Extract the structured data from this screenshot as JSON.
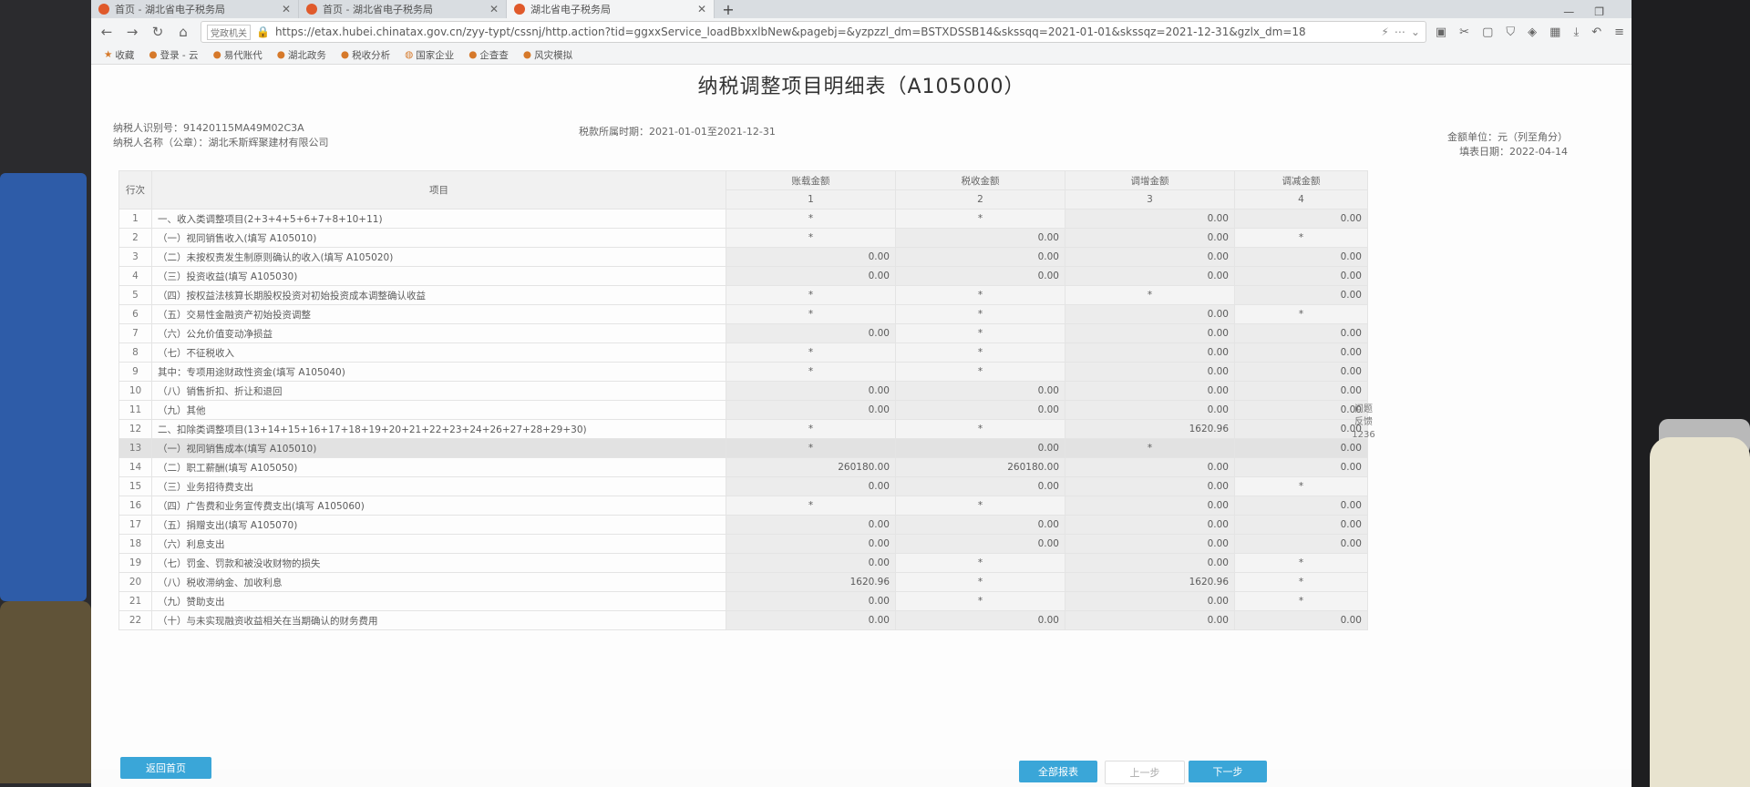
{
  "browser": {
    "tabs": [
      {
        "label": "首页 - 湖北省电子税务局",
        "active": false
      },
      {
        "label": "首页 - 湖北省电子税务局",
        "active": false
      },
      {
        "label": "湖北省电子税务局",
        "active": true
      }
    ],
    "new_tab": "+",
    "url_badge": "党政机关",
    "url": "https://etax.hubei.chinatax.gov.cn/zyy-typt/cssnj/http.action?tid=ggxxService_loadBbxxlbNew&pagebj=&yzpzzl_dm=BSTXDSSB14&skssqq=2021-01-01&skssqz=2021-12-31&gzlx_dm=18",
    "bookmarks": [
      "收藏",
      "登录 - 云",
      "易代账代",
      "湖北政务",
      "税收分析",
      "国家企业",
      "企查查",
      "风灾模拟"
    ]
  },
  "page": {
    "title": "纳税调整项目明细表（A105000）",
    "taxpayer_id": "纳税人识别号：91420115MA49M02C3A",
    "taxpayer_name": "纳税人名称（公章）：湖北禾斯辉聚建材有限公司",
    "period": "税款所属时期：2021-01-01至2021-12-31",
    "unit": "金额单位：元（列至角分）",
    "fill_date": "填表日期：2022-04-14",
    "side_float": [
      "问题",
      "反馈",
      "1236"
    ]
  },
  "table": {
    "headers": {
      "row_no": "行次",
      "item": "项目",
      "col1": "账载金额",
      "col2": "税收金额",
      "col3": "调增金额",
      "col4": "调减金额",
      "idx1": "1",
      "idx2": "2",
      "idx3": "3",
      "idx4": "4"
    },
    "rows": [
      {
        "no": "1",
        "item": "一、收入类调整项目(2+3+4+5+6+7+8+10+11)",
        "c1": "*",
        "c2": "*",
        "c3": "0.00",
        "c4": "0.00"
      },
      {
        "no": "2",
        "item": "（一）视同销售收入(填写 A105010)",
        "c1": "*",
        "c2": "0.00",
        "c3": "0.00",
        "c4": "*"
      },
      {
        "no": "3",
        "item": "（二）未按权责发生制原则确认的收入(填写 A105020)",
        "c1": "0.00",
        "c2": "0.00",
        "c3": "0.00",
        "c4": "0.00"
      },
      {
        "no": "4",
        "item": "（三）投资收益(填写 A105030)",
        "c1": "0.00",
        "c2": "0.00",
        "c3": "0.00",
        "c4": "0.00"
      },
      {
        "no": "5",
        "item": "（四）按权益法核算长期股权投资对初始投资成本调整确认收益",
        "c1": "*",
        "c2": "*",
        "c3": "*",
        "c4": "0.00"
      },
      {
        "no": "6",
        "item": "（五）交易性金融资产初始投资调整",
        "c1": "*",
        "c2": "*",
        "c3": "0.00",
        "c4": "*"
      },
      {
        "no": "7",
        "item": "（六）公允价值变动净损益",
        "c1": "0.00",
        "c2": "*",
        "c3": "0.00",
        "c4": "0.00"
      },
      {
        "no": "8",
        "item": "（七）不征税收入",
        "c1": "*",
        "c2": "*",
        "c3": "0.00",
        "c4": "0.00"
      },
      {
        "no": "9",
        "item": "其中：专项用途财政性资金(填写 A105040)",
        "c1": "*",
        "c2": "*",
        "c3": "0.00",
        "c4": "0.00"
      },
      {
        "no": "10",
        "item": "（八）销售折扣、折让和退回",
        "c1": "0.00",
        "c2": "0.00",
        "c3": "0.00",
        "c4": "0.00"
      },
      {
        "no": "11",
        "item": "（九）其他",
        "c1": "0.00",
        "c2": "0.00",
        "c3": "0.00",
        "c4": "0.00"
      },
      {
        "no": "12",
        "item": "二、扣除类调整项目(13+14+15+16+17+18+19+20+21+22+23+24+26+27+28+29+30)",
        "c1": "*",
        "c2": "*",
        "c3": "1620.96",
        "c4": "0.00"
      },
      {
        "no": "13",
        "item": "（一）视同销售成本(填写 A105010)",
        "c1": "*",
        "c2": "0.00",
        "c3": "*",
        "c4": "0.00"
      },
      {
        "no": "14",
        "item": "（二）职工薪酬(填写 A105050)",
        "c1": "260180.00",
        "c2": "260180.00",
        "c3": "0.00",
        "c4": "0.00"
      },
      {
        "no": "15",
        "item": "（三）业务招待费支出",
        "c1": "0.00",
        "c2": "0.00",
        "c3": "0.00",
        "c4": "*"
      },
      {
        "no": "16",
        "item": "（四）广告费和业务宣传费支出(填写 A105060)",
        "c1": "*",
        "c2": "*",
        "c3": "0.00",
        "c4": "0.00"
      },
      {
        "no": "17",
        "item": "（五）捐赠支出(填写 A105070)",
        "c1": "0.00",
        "c2": "0.00",
        "c3": "0.00",
        "c4": "0.00"
      },
      {
        "no": "18",
        "item": "（六）利息支出",
        "c1": "0.00",
        "c2": "0.00",
        "c3": "0.00",
        "c4": "0.00"
      },
      {
        "no": "19",
        "item": "（七）罚金、罚款和被没收财物的损失",
        "c1": "0.00",
        "c2": "*",
        "c3": "0.00",
        "c4": "*"
      },
      {
        "no": "20",
        "item": "（八）税收滞纳金、加收利息",
        "c1": "1620.96",
        "c2": "*",
        "c3": "1620.96",
        "c4": "*"
      },
      {
        "no": "21",
        "item": "（九）赞助支出",
        "c1": "0.00",
        "c2": "*",
        "c3": "0.00",
        "c4": "*"
      },
      {
        "no": "22",
        "item": "（十）与未实现融资收益相关在当期确认的财务费用",
        "c1": "0.00",
        "c2": "0.00",
        "c3": "0.00",
        "c4": "0.00"
      }
    ]
  },
  "buttons": {
    "back": "返回首页",
    "all_forms": "全部报表",
    "prev": "上一步",
    "next": "下一步"
  }
}
